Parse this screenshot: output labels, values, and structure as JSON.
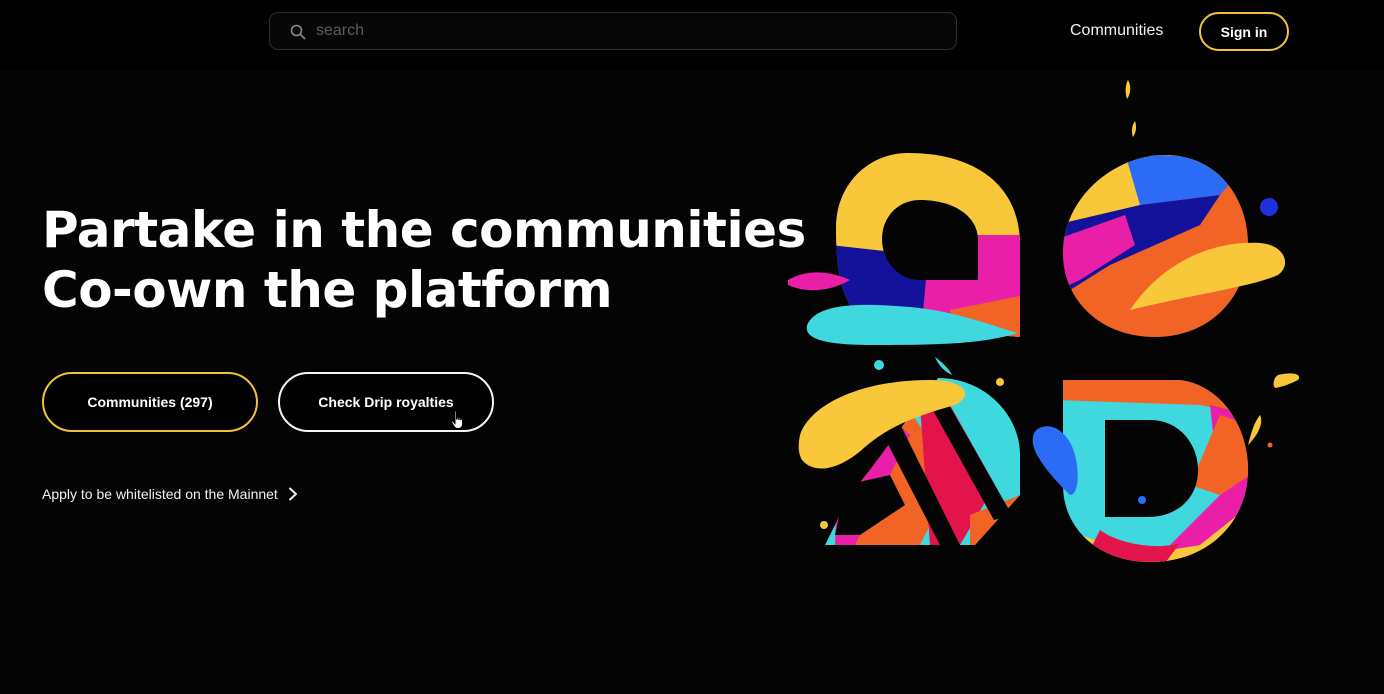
{
  "header": {
    "search": {
      "placeholder": "search"
    },
    "nav_communities": "Communities",
    "signin_label": "Sign in"
  },
  "hero": {
    "title_line1": "Partake in the communities",
    "title_line2": "Co-own the platform",
    "primary_button": "Communities (297)",
    "secondary_button": "Check Drip royalties",
    "whitelist_link": "Apply to be whitelisted on the Mainnet"
  },
  "colors": {
    "accent_yellow": "#f3c23a",
    "magenta": "#e91fa7",
    "navy": "#14129a",
    "cyan": "#3fd8de",
    "orange": "#f26426",
    "red": "#e3144c",
    "blue": "#2b6bf5",
    "background": "#040404"
  }
}
